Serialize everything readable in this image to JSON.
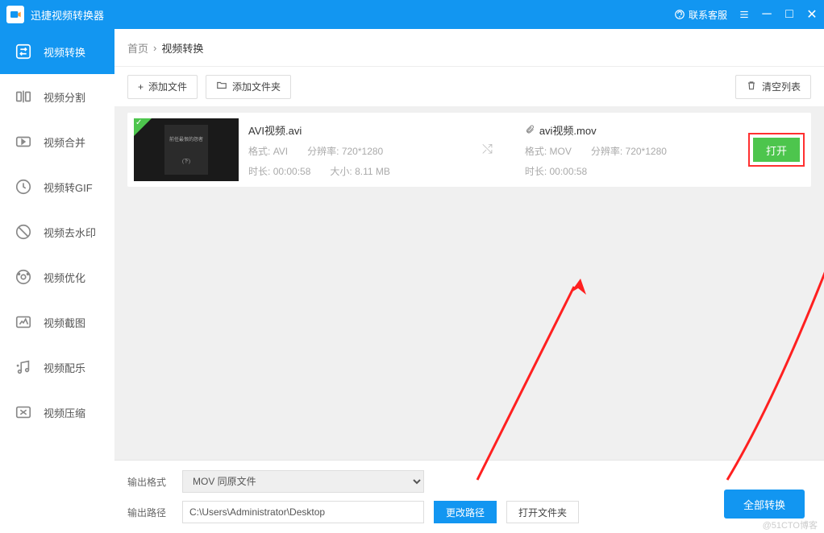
{
  "titlebar": {
    "app_name": "迅捷视频转换器",
    "contact": "联系客服"
  },
  "sidebar": {
    "items": [
      {
        "label": "视频转换"
      },
      {
        "label": "视频分割"
      },
      {
        "label": "视频合并"
      },
      {
        "label": "视频转GIF"
      },
      {
        "label": "视频去水印"
      },
      {
        "label": "视频优化"
      },
      {
        "label": "视频截图"
      },
      {
        "label": "视频配乐"
      },
      {
        "label": "视频压缩"
      }
    ]
  },
  "breadcrumb": {
    "home": "首页",
    "current": "视频转换"
  },
  "toolbar": {
    "add_file": "添加文件",
    "add_folder": "添加文件夹",
    "clear_list": "清空列表"
  },
  "file": {
    "source": {
      "name": "AVI视频.avi",
      "format_label": "格式:",
      "format": "AVI",
      "resolution_label": "分辨率:",
      "resolution": "720*1280",
      "duration_label": "时长:",
      "duration": "00:00:58",
      "size_label": "大小:",
      "size": "8.11 MB"
    },
    "target": {
      "name": "avi视频.mov",
      "format_label": "格式:",
      "format": "MOV",
      "resolution_label": "分辨率:",
      "resolution": "720*1280",
      "duration_label": "时长:",
      "duration": "00:00:58"
    },
    "open_button": "打开",
    "thumb_text1": "前任最恨的怨者",
    "thumb_text2": "(下)"
  },
  "bottom": {
    "format_label": "输出格式",
    "format_value": "MOV  同原文件",
    "path_label": "输出路径",
    "path_value": "C:\\Users\\Administrator\\Desktop",
    "change_path": "更改路径",
    "open_folder": "打开文件夹",
    "convert_all": "全部转换"
  },
  "watermark": "@51CTO博客"
}
